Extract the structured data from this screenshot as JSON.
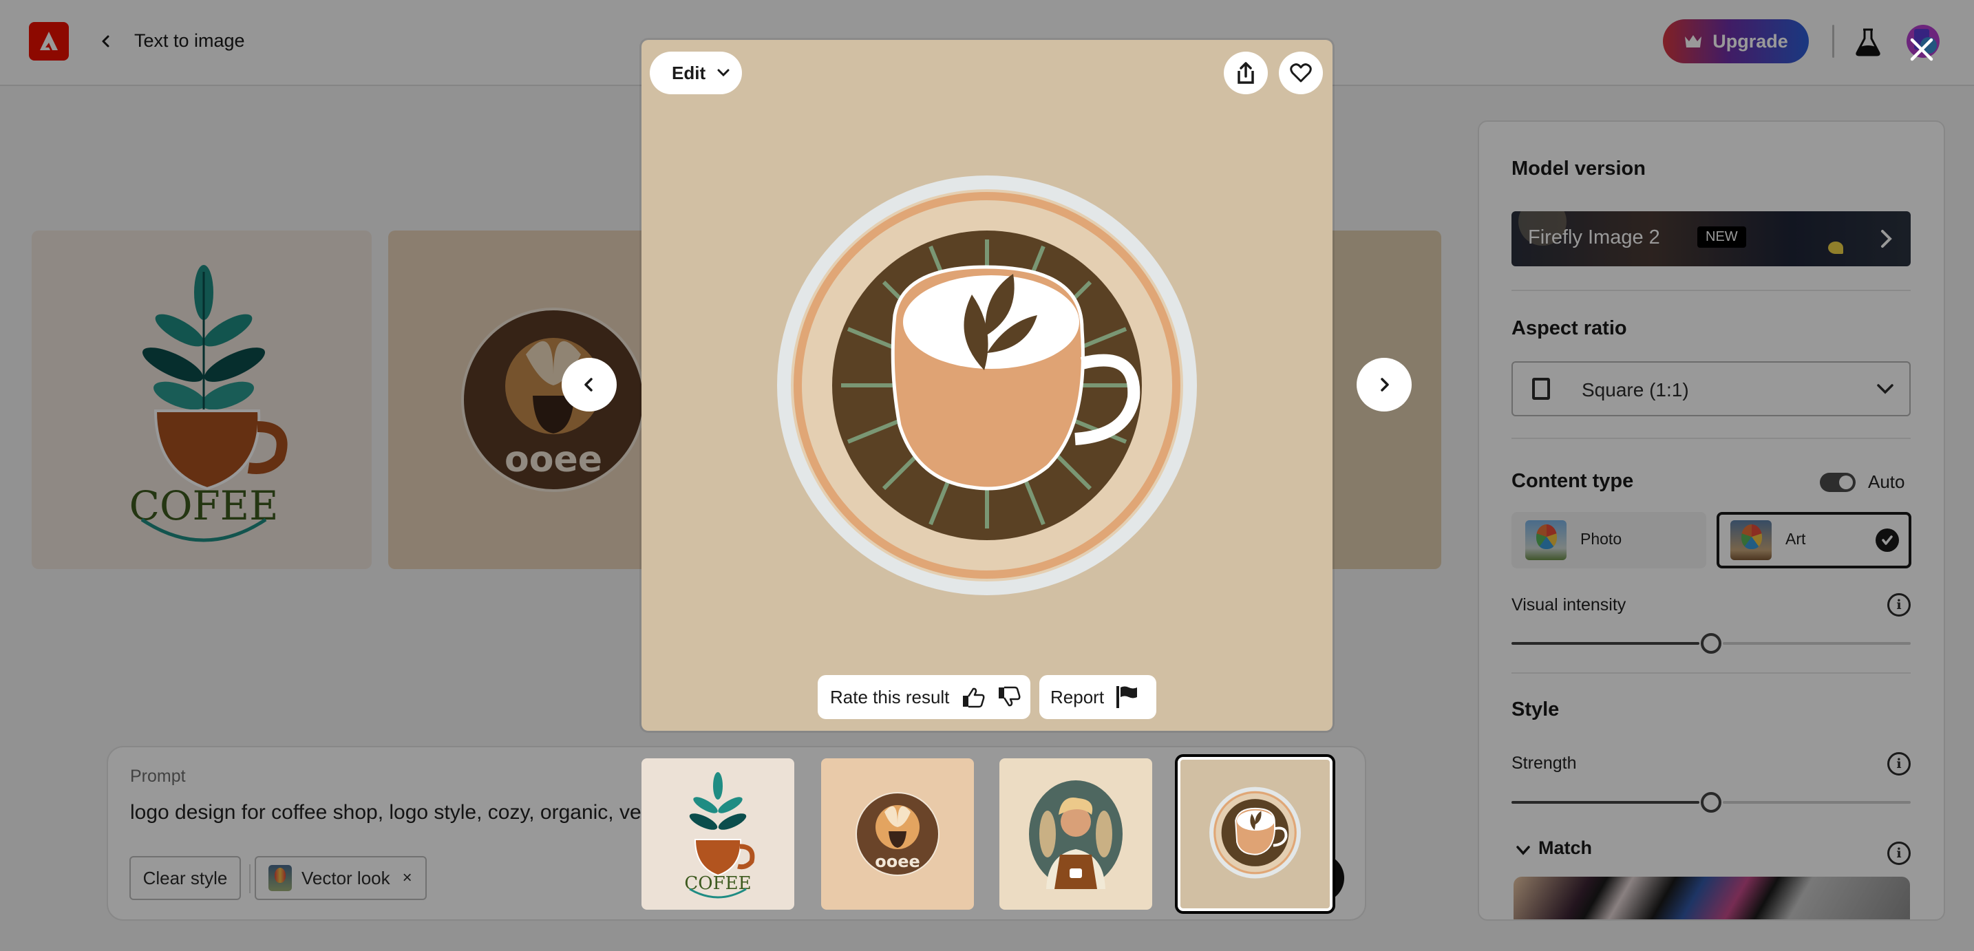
{
  "header": {
    "title": "Text to image",
    "upgrade_label": "Upgrade"
  },
  "panel": {
    "model_version": {
      "title": "Model version",
      "model_name": "Firefly Image 2",
      "badge": "NEW"
    },
    "aspect_ratio": {
      "title": "Aspect ratio",
      "selected": "Square (1:1)"
    },
    "content_type": {
      "title": "Content type",
      "auto_label": "Auto",
      "auto_enabled": true,
      "options": [
        {
          "label": "Photo",
          "selected": false
        },
        {
          "label": "Art",
          "selected": true
        }
      ]
    },
    "visual_intensity": {
      "label": "Visual intensity",
      "value_percent": 50
    },
    "style": {
      "title": "Style",
      "strength_label": "Strength",
      "strength_value_percent": 50,
      "match_label": "Match"
    }
  },
  "prompt": {
    "label": "Prompt",
    "text_visible": "logo design for coffee shop, logo style, cozy, organic, vecto",
    "clear_style_label": "Clear style",
    "style_chip_label": "Vector look",
    "style_chip_remove": "×"
  },
  "viewer": {
    "edit_label": "Edit",
    "rate_label": "Rate this result",
    "report_label": "Report",
    "selected_index": 4,
    "thumbnails": [
      {
        "name": "teal-leaf-cup-cofee-logo"
      },
      {
        "name": "brown-round-coffee-badge-logo"
      },
      {
        "name": "barista-portrait-logo"
      },
      {
        "name": "latte-leaf-cup-round-logo"
      }
    ]
  },
  "colors": {
    "upgrade_gradient_start": "#d7373f",
    "upgrade_gradient_end": "#2c5fd6",
    "adobe_red": "#eb1000",
    "viewer_bg": "#d1bfa3"
  }
}
